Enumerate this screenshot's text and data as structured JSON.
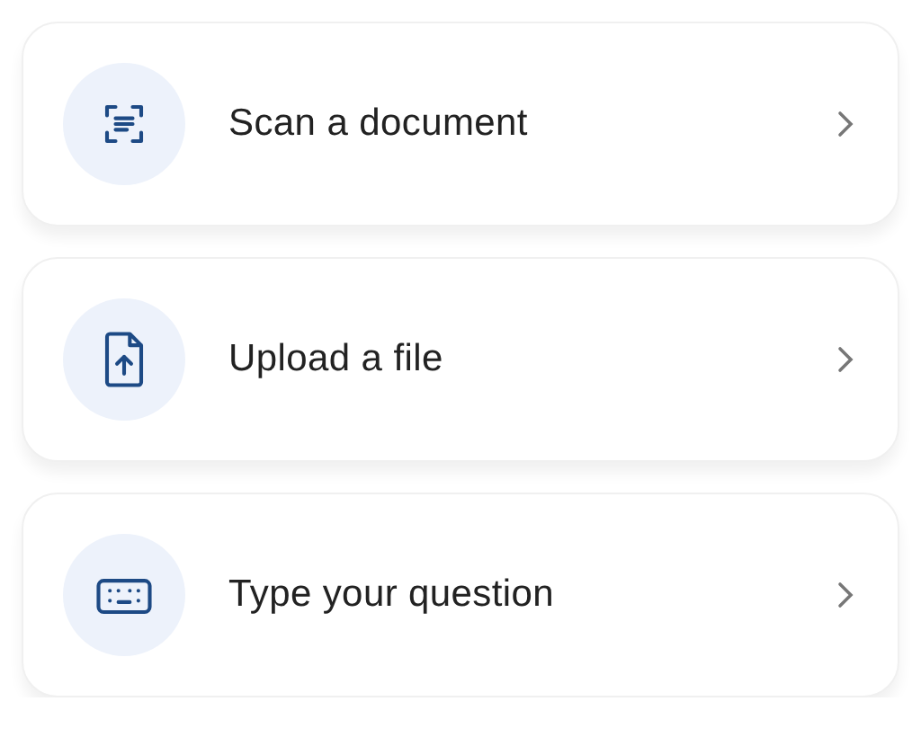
{
  "options": [
    {
      "kind": "scan",
      "label": "Scan a document"
    },
    {
      "kind": "upload",
      "label": "Upload a file"
    },
    {
      "kind": "keyboard",
      "label": "Type your question"
    }
  ]
}
